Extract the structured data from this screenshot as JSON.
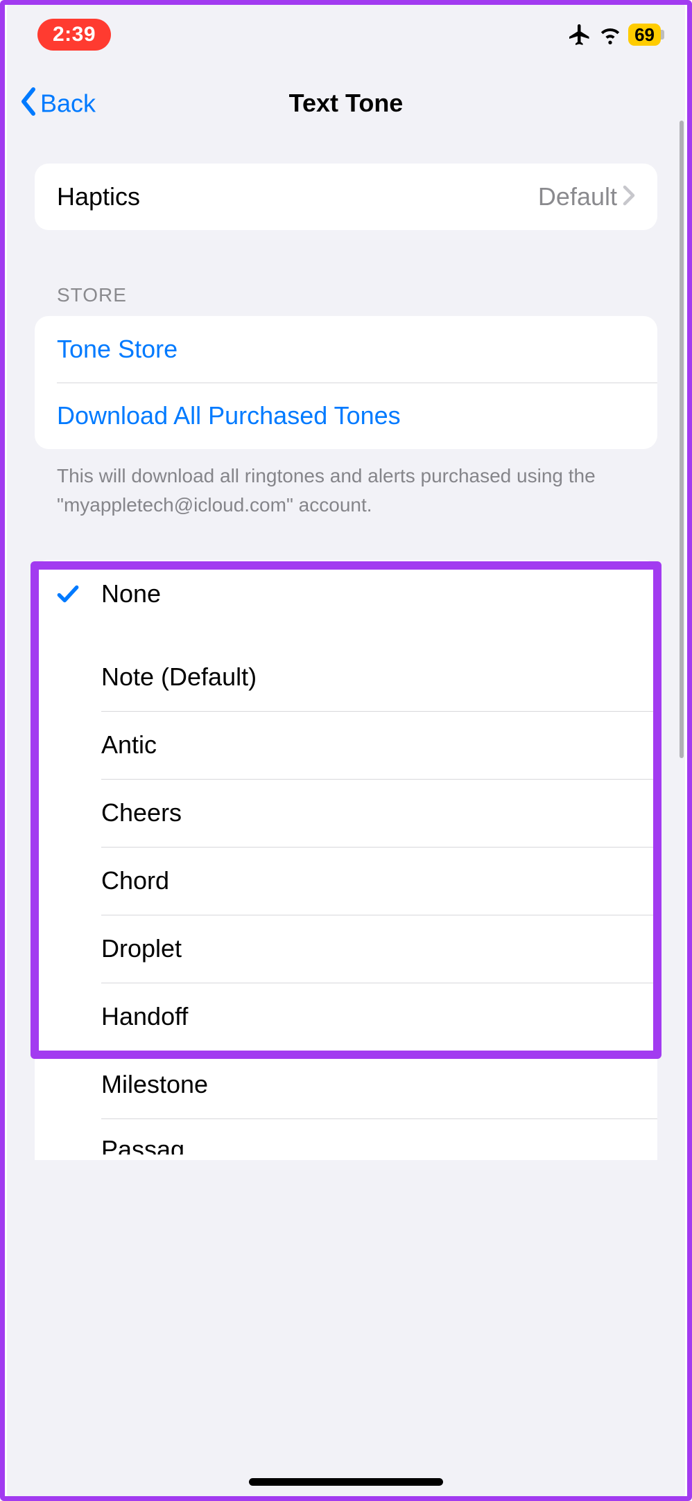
{
  "status": {
    "time": "2:39",
    "battery_pct": "69"
  },
  "nav": {
    "back_label": "Back",
    "title": "Text Tone"
  },
  "haptics": {
    "label": "Haptics",
    "value": "Default"
  },
  "store": {
    "header": "STORE",
    "tone_store": "Tone Store",
    "download_all": "Download All Purchased Tones",
    "footer": "This will download all ringtones and alerts purchased using the \"myappletech@icloud.com\" account."
  },
  "tones": {
    "selected_index": 0,
    "items": [
      {
        "label": "None"
      },
      {
        "label": "Note (Default)"
      },
      {
        "label": "Antic"
      },
      {
        "label": "Cheers"
      },
      {
        "label": "Chord"
      },
      {
        "label": "Droplet"
      },
      {
        "label": "Handoff"
      },
      {
        "label": "Milestone"
      },
      {
        "label": "Passag"
      }
    ]
  }
}
